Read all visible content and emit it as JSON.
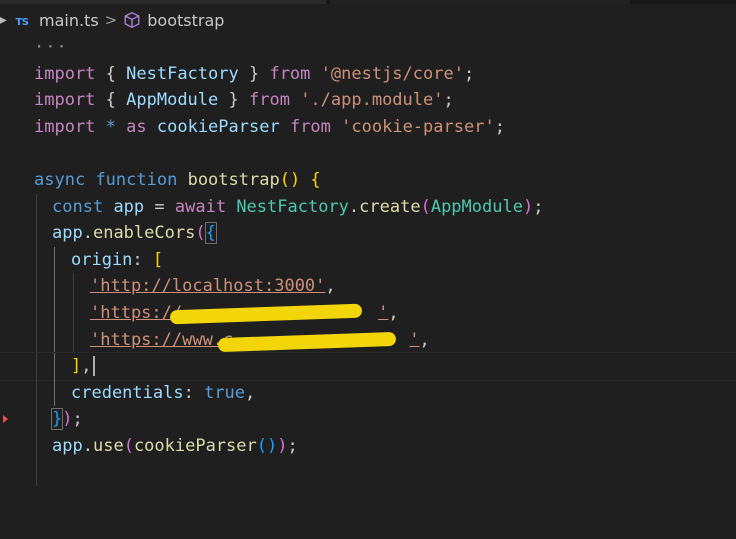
{
  "breadcrumb": {
    "file_icon": "TS",
    "file": "main.ts",
    "separator": ">",
    "symbol_icon": "cube-icon",
    "symbol": "bootstrap"
  },
  "code": {
    "folded": "···",
    "line_import_nest": {
      "kw": "import",
      "open": " { ",
      "name": "NestFactory",
      "close": " } ",
      "from": "from",
      "space": " ",
      "src": "'@nestjs/core'",
      "semi": ";"
    },
    "line_import_app": {
      "kw": "import",
      "open": " { ",
      "name": "AppModule",
      "close": " } ",
      "from": "from",
      "space": " ",
      "src": "'./app.module'",
      "semi": ";"
    },
    "line_import_cookie": {
      "kw": "import",
      "star": " * ",
      "as": "as",
      "space1": " ",
      "name": "cookieParser",
      "space2": " ",
      "from": "from",
      "space3": " ",
      "src": "'cookie-parser'",
      "semi": ";"
    },
    "line_async": {
      "async": "async",
      "space1": " ",
      "function": "function",
      "space2": " ",
      "name": "bootstrap",
      "parens": "()",
      "brace": " {"
    },
    "line_const": {
      "const": "const",
      "space1": " ",
      "var": "app",
      "eq": " = ",
      "await": "await",
      "space2": " ",
      "cls": "NestFactory",
      "dot": ".",
      "method": "create",
      "open": "(",
      "arg": "AppModule",
      "close": ")",
      "semi": ";"
    },
    "line_enable": {
      "var": "app",
      "dot": ".",
      "method": "enableCors",
      "open": "(",
      "brace": "{"
    },
    "line_origin": {
      "key": "origin",
      "colon": ": ",
      "bracket": "["
    },
    "line_url1": {
      "url": "'http://localhost:3000'",
      "comma": ","
    },
    "line_url2": {
      "url": "'https://",
      "tail": "'",
      "comma": ","
    },
    "line_url3": {
      "url": "'https://www.c",
      "tail": "'",
      "comma": ","
    },
    "line_close_arr": {
      "bracket": "]",
      "comma": ","
    },
    "line_credentials": {
      "key": "credentials",
      "colon": ": ",
      "value": "true",
      "comma": ","
    },
    "line_close_call": {
      "brace": "}",
      "paren": ")",
      "semi": ";"
    },
    "line_use": {
      "var": "app",
      "dot": ".",
      "method": "use",
      "open": "(",
      "arg": "cookieParser",
      "inner": "()",
      "close": ")",
      "semi": ";"
    }
  },
  "colors": {
    "background": "#1f1f1f",
    "keyword": "#569cd6",
    "control_keyword": "#c586c0",
    "function": "#dcdcaa",
    "class": "#4ec9b0",
    "variable": "#9cdcfe",
    "string": "#ce9178",
    "redaction": "#f2d60a"
  }
}
